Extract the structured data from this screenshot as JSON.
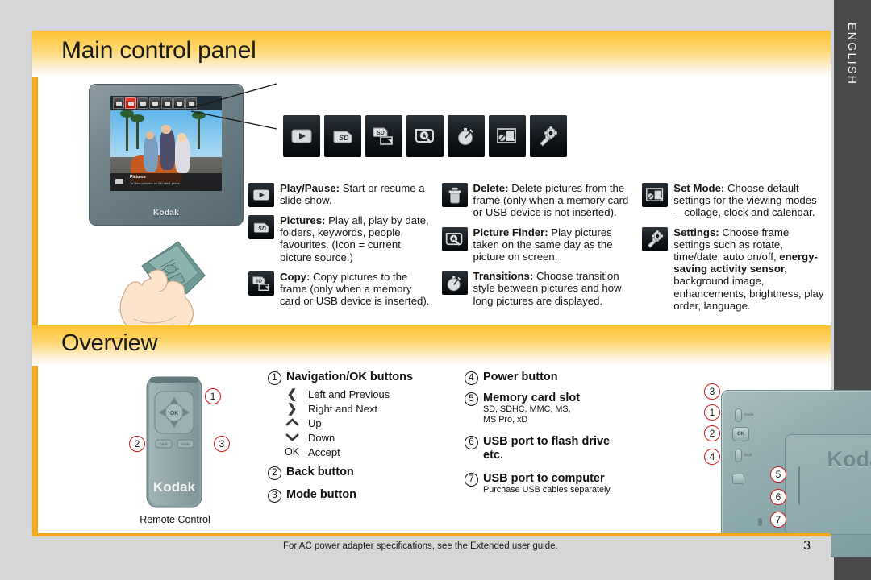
{
  "language_tab": "ENGLISH",
  "sections": {
    "main_control_panel": {
      "title": "Main control panel",
      "device_screen": {
        "caption_title": "Pictures",
        "caption_sub": "To view pictures on SD card, press",
        "brand": "Kodak"
      },
      "icon_strip": [
        "play-icon",
        "sd-card-icon",
        "copy-icon",
        "picture-finder-icon",
        "transitions-icon",
        "set-mode-icon",
        "settings-icon"
      ],
      "features": [
        {
          "icon": "play-icon",
          "label": "Play/Pause:",
          "text": " Start or resume a slide show.",
          "column": 1
        },
        {
          "icon": "sd-card-icon",
          "label": "Pictures:",
          "text": " Play all, play by date, folders, keywords, people, favourites. (Icon = current picture source.)",
          "column": 1
        },
        {
          "icon": "copy-icon",
          "label": "Copy:",
          "text": " Copy pictures to the frame (only when a memory card or USB device is inserted).",
          "column": 1
        },
        {
          "icon": "delete-icon",
          "label": "Delete:",
          "text": " Delete pictures from the frame (only when a memory card or USB device is not inserted).",
          "column": 2
        },
        {
          "icon": "picture-finder-icon",
          "label": "Picture Finder:",
          "text": " Play pictures taken on the same day as the picture on screen.",
          "column": 2
        },
        {
          "icon": "transitions-icon",
          "label": "Transitions:",
          "text": " Choose transition style between pictures and how long pictures are displayed.",
          "column": 2
        },
        {
          "icon": "set-mode-icon",
          "label": "Set Mode:",
          "text": " Choose default settings for the viewing modes—collage, clock and calendar.",
          "column": 3
        },
        {
          "icon": "settings-icon",
          "label": "Settings:",
          "text": " Choose frame settings such as rotate, time/date, auto on/off, energy-saving activity sensor, background image, enhancements, brightness, play order, language.",
          "column": 3,
          "bold_run": "energy-saving activity sensor,"
        }
      ]
    },
    "overview": {
      "title": "Overview",
      "remote": {
        "caption": "Remote Control",
        "brand": "Kodak",
        "ok_label": "OK",
        "back_label": "back",
        "mode_label": "mode",
        "callouts": [
          "1",
          "2",
          "3"
        ]
      },
      "back_device": {
        "brand": "Koda",
        "ok_label": "OK",
        "back_label": "back",
        "mode_label": "mode",
        "callouts": [
          "3",
          "1",
          "2",
          "4",
          "5",
          "6",
          "7"
        ]
      },
      "list_left": [
        {
          "num": "1",
          "label": "Navigation/OK buttons",
          "rows": [
            {
              "glyph": "❮",
              "text": "Left and Previous"
            },
            {
              "glyph": "❯",
              "text": "Right and Next"
            },
            {
              "glyph": "︿",
              "text": "Up"
            },
            {
              "glyph": "﹀",
              "text": "Down"
            },
            {
              "glyph": "OK",
              "text": "Accept"
            }
          ]
        },
        {
          "num": "2",
          "label": "Back button",
          "rows": []
        },
        {
          "num": "3",
          "label": "Mode button",
          "rows": []
        }
      ],
      "list_right": [
        {
          "num": "4",
          "label": "Power button",
          "sub": ""
        },
        {
          "num": "5",
          "label": "Memory card slot",
          "sub": "SD, SDHC, MMC, MS,\nMS Pro, xD"
        },
        {
          "num": "6",
          "label": "USB port to flash drive etc.",
          "sub": ""
        },
        {
          "num": "7",
          "label": "USB port to computer",
          "sub": "Purchase USB cables separately."
        }
      ]
    }
  },
  "footer": {
    "note": "For AC power adapter specifications, see the Extended user guide.",
    "page_number": "3"
  },
  "colors": {
    "accent_orange": "#f4a81d",
    "header_gradient_top": "#ffc233",
    "band_gray": "#4a4a4a",
    "page_gray": "#d7d7d7",
    "callout_red": "#cf1a1a"
  }
}
